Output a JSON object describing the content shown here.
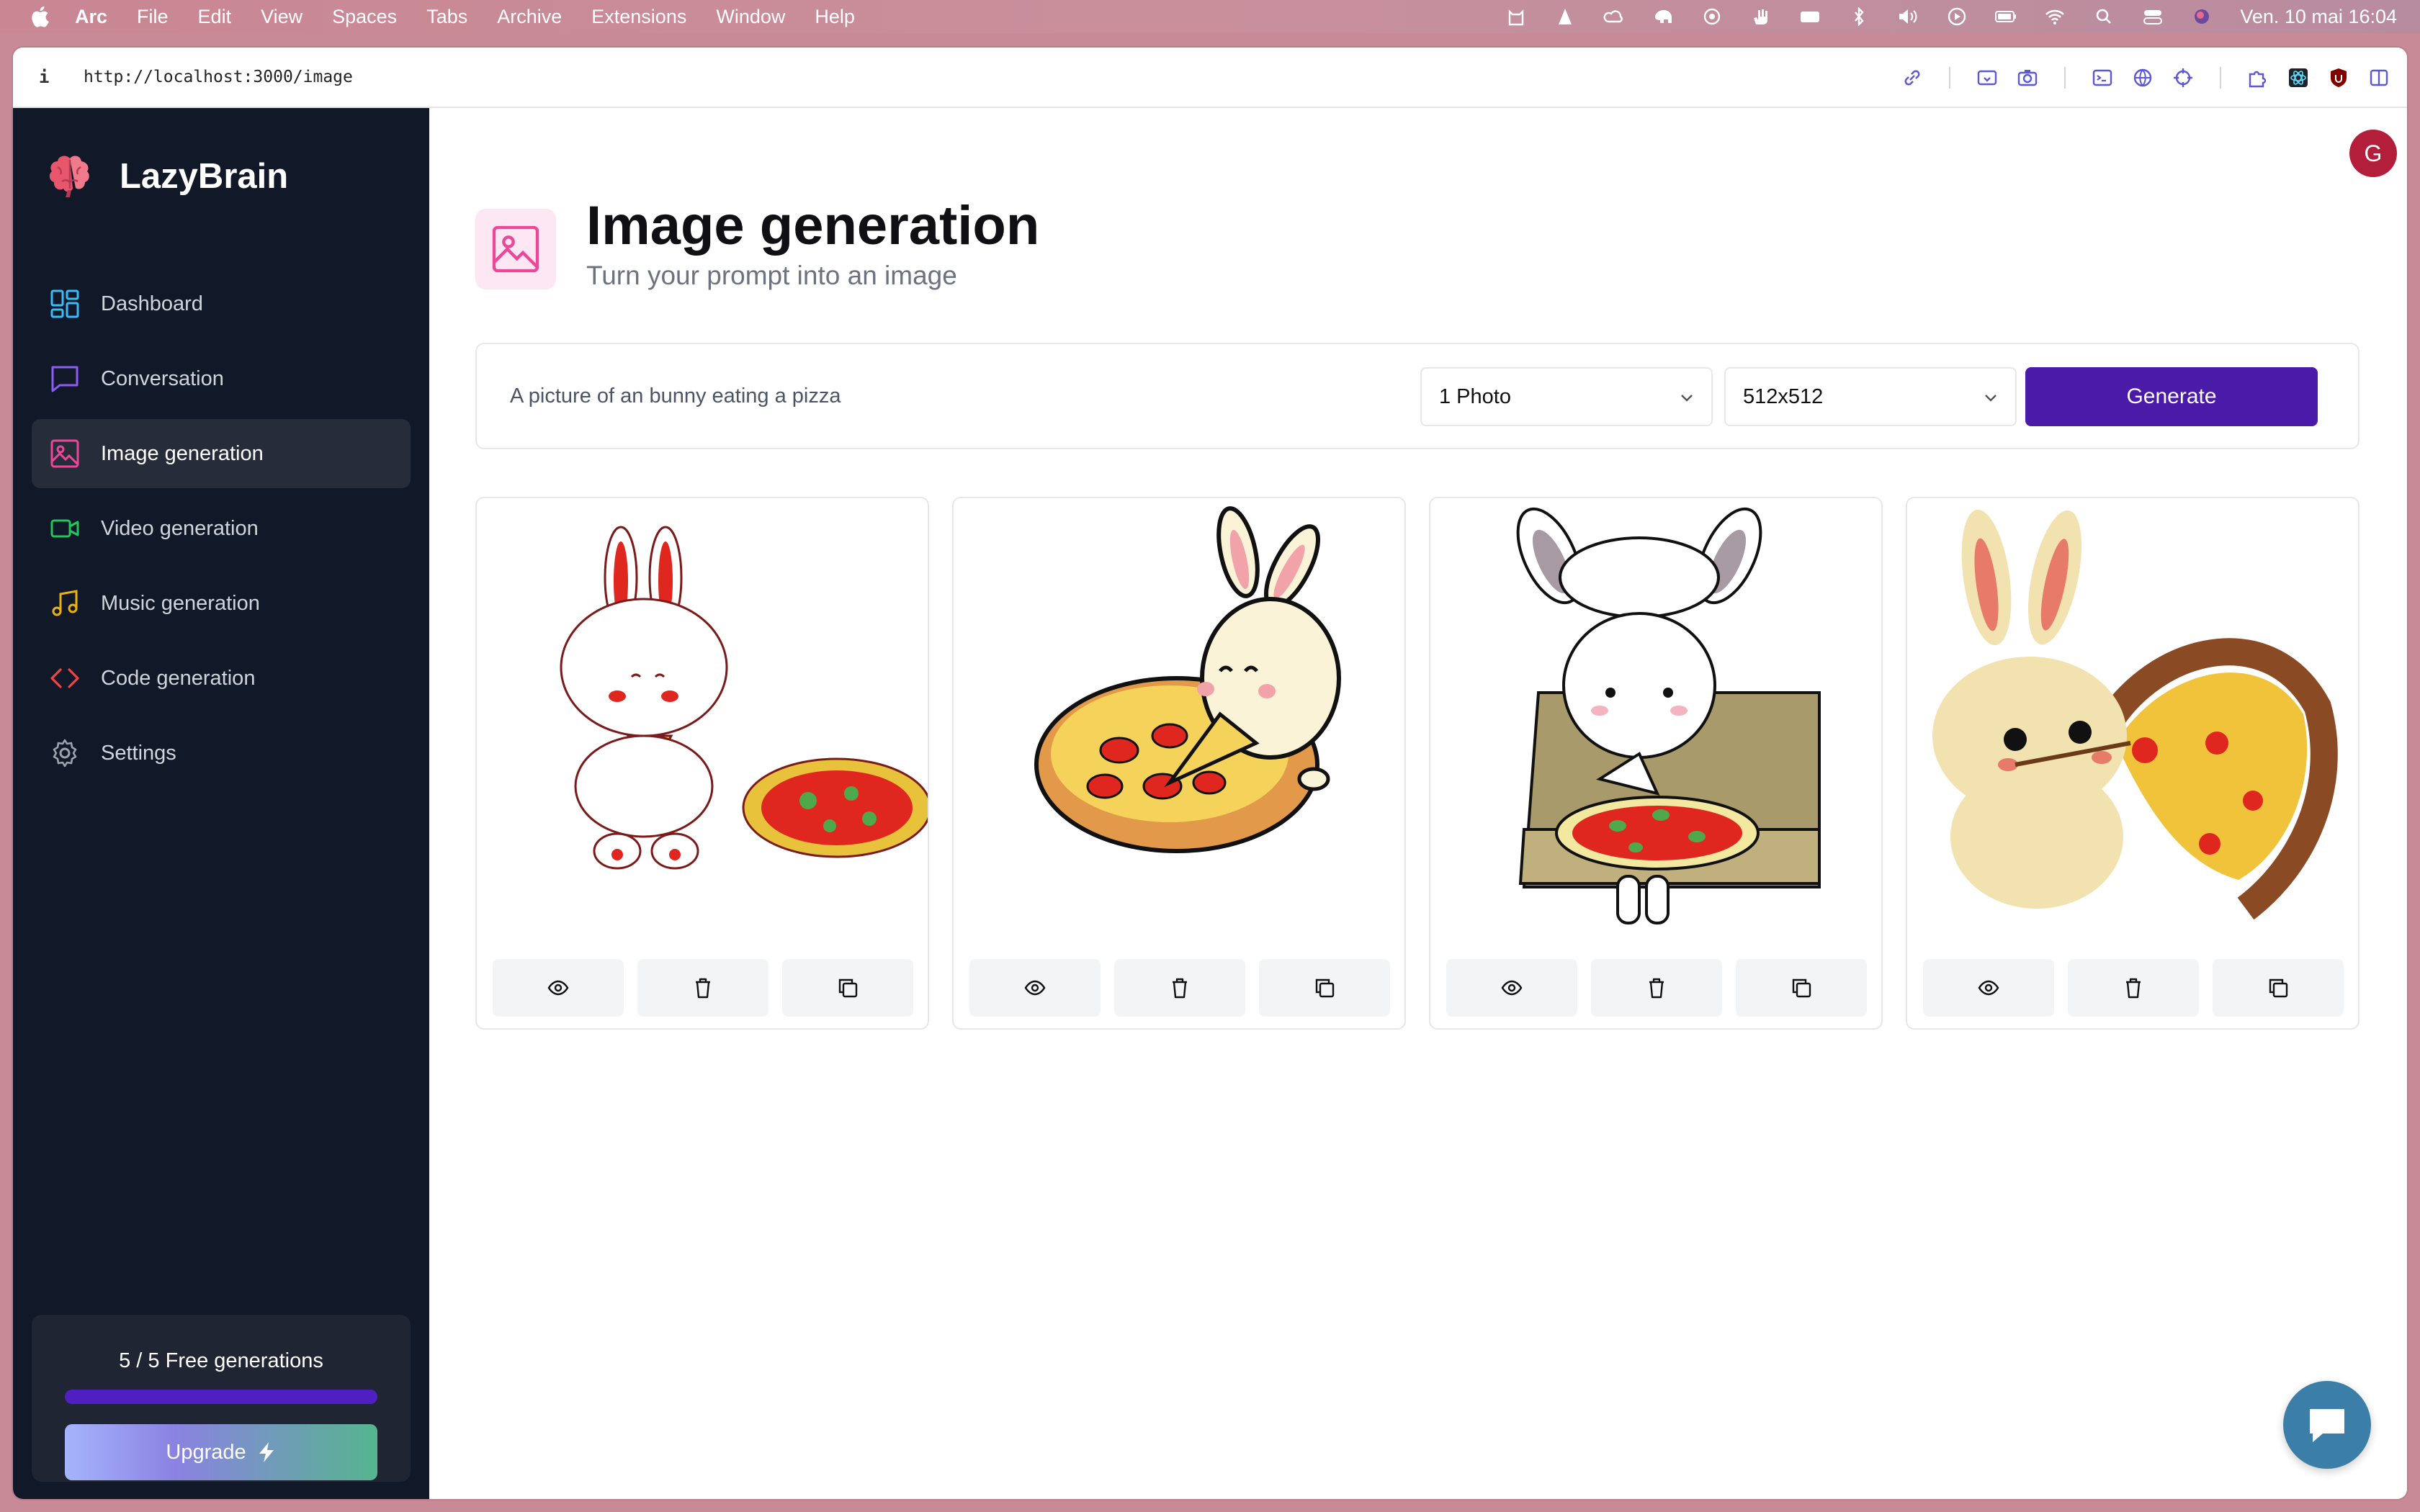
{
  "menubar": {
    "app": "Arc",
    "items": [
      "File",
      "Edit",
      "View",
      "Spaces",
      "Tabs",
      "Archive",
      "Extensions",
      "Window",
      "Help"
    ],
    "clock": "Ven. 10 mai  16:04"
  },
  "browser": {
    "info_glyph": "i",
    "url": "http://localhost:3000/image"
  },
  "sidebar": {
    "brand": "LazyBrain",
    "items": [
      {
        "label": "Dashboard",
        "icon": "dashboard-icon",
        "color": "#38bdf8"
      },
      {
        "label": "Conversation",
        "icon": "chat-icon",
        "color": "#8b5cf6"
      },
      {
        "label": "Image generation",
        "icon": "image-icon",
        "color": "#ec4899"
      },
      {
        "label": "Video generation",
        "icon": "video-icon",
        "color": "#22c55e"
      },
      {
        "label": "Music generation",
        "icon": "music-icon",
        "color": "#eab308"
      },
      {
        "label": "Code generation",
        "icon": "code-icon",
        "color": "#ef4444"
      },
      {
        "label": "Settings",
        "icon": "gear-icon",
        "color": "#9ca3af"
      }
    ],
    "active": "Image generation",
    "free_generations": "5 / 5 Free generations",
    "generations_used_fraction": 1.0,
    "upgrade_label": "Upgrade"
  },
  "header": {
    "avatar_initial": "G",
    "title": "Image generation",
    "subtitle": "Turn your prompt into an image"
  },
  "form": {
    "prompt_value": "A picture of an bunny eating a pizza",
    "amount": "1 Photo",
    "resolution": "512x512",
    "generate_label": "Generate"
  },
  "colors": {
    "accent": "#4a1aa8",
    "sidebar_bg": "#111827",
    "avatar": "#b31f3b"
  },
  "images": [
    {
      "icon": "bunny-eating-pizza-image-1"
    },
    {
      "icon": "bunny-eating-pizza-image-2"
    },
    {
      "icon": "bunny-eating-pizza-image-3"
    },
    {
      "icon": "bunny-eating-pizza-image-4"
    }
  ]
}
